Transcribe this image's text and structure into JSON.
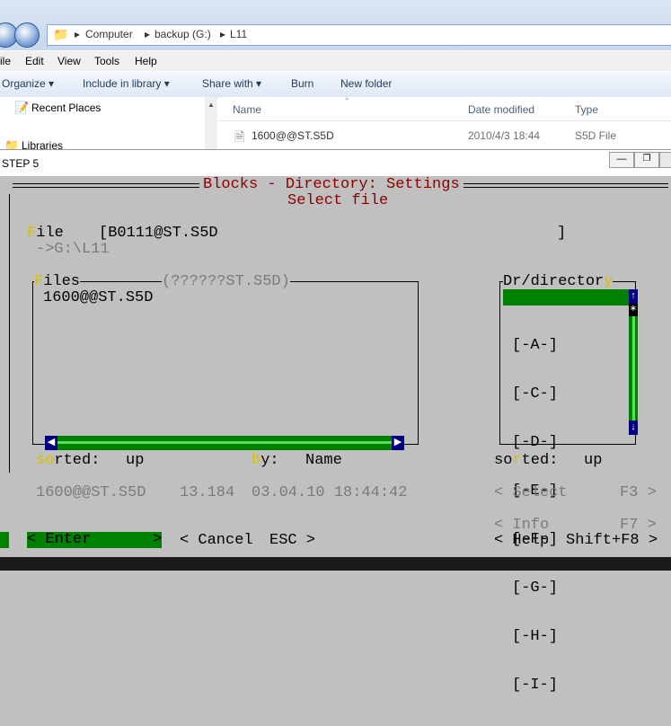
{
  "explorer": {
    "breadcrumb": [
      "Computer",
      "backup (G:)",
      "L11"
    ],
    "menu": [
      "ile",
      "Edit",
      "View",
      "Tools",
      "Help"
    ],
    "toolbar": [
      "Organize",
      "Include in library",
      "Share with",
      "Burn",
      "New folder"
    ],
    "nav": [
      "Recent Places",
      "Libraries"
    ],
    "columns": [
      "Name",
      "Date modified",
      "Type"
    ],
    "file": {
      "name": "1600@@ST.S5D",
      "date": "2010/4/3 18:44",
      "type": "S5D File"
    }
  },
  "window": {
    "title": "STEP 5"
  },
  "dialog": {
    "title": "Blocks - Directory: Settings",
    "subtitle": "Select file",
    "file_label_F": "F",
    "file_label_rest": "ile",
    "file_value": "[B0111@ST.S5D",
    "file_bracket_close": "]",
    "path": "->G:\\L11",
    "files_label_F": "F",
    "files_label_rest": "iles",
    "files_filter": "(??????ST.S5D)",
    "files_list": [
      "1600@@ST.S5D"
    ],
    "dir_label_main": "Dr/director",
    "dir_label_y": "y",
    "dir_list": [
      "[-A-]",
      "[-C-]",
      "[-D-]",
      "[-E-]",
      "[-F-]",
      "[-G-]",
      "[-H-]",
      "[-I-]"
    ],
    "sorted_label_so": "so",
    "sorted_label_r": "r",
    "sorted_label_rest": "ted:",
    "sorted_value": "up",
    "by_label_b": "b",
    "by_label_rest": "y:",
    "by_value": "Name",
    "sorted2_value": "up",
    "info_line": {
      "name": "1600@@ST.S5D",
      "size": "13.184",
      "date": "03.04.10 18:44:42"
    },
    "select_label": "< Select",
    "select_key": "F3 >",
    "info_label": "< Info",
    "info_key": "F7 >",
    "enter_label": "< Enter",
    "enter_close": ">",
    "cancel_label": "< Cancel",
    "cancel_key": "ESC >",
    "help_label": "< Help",
    "help_key": "Shift+F8 >"
  }
}
